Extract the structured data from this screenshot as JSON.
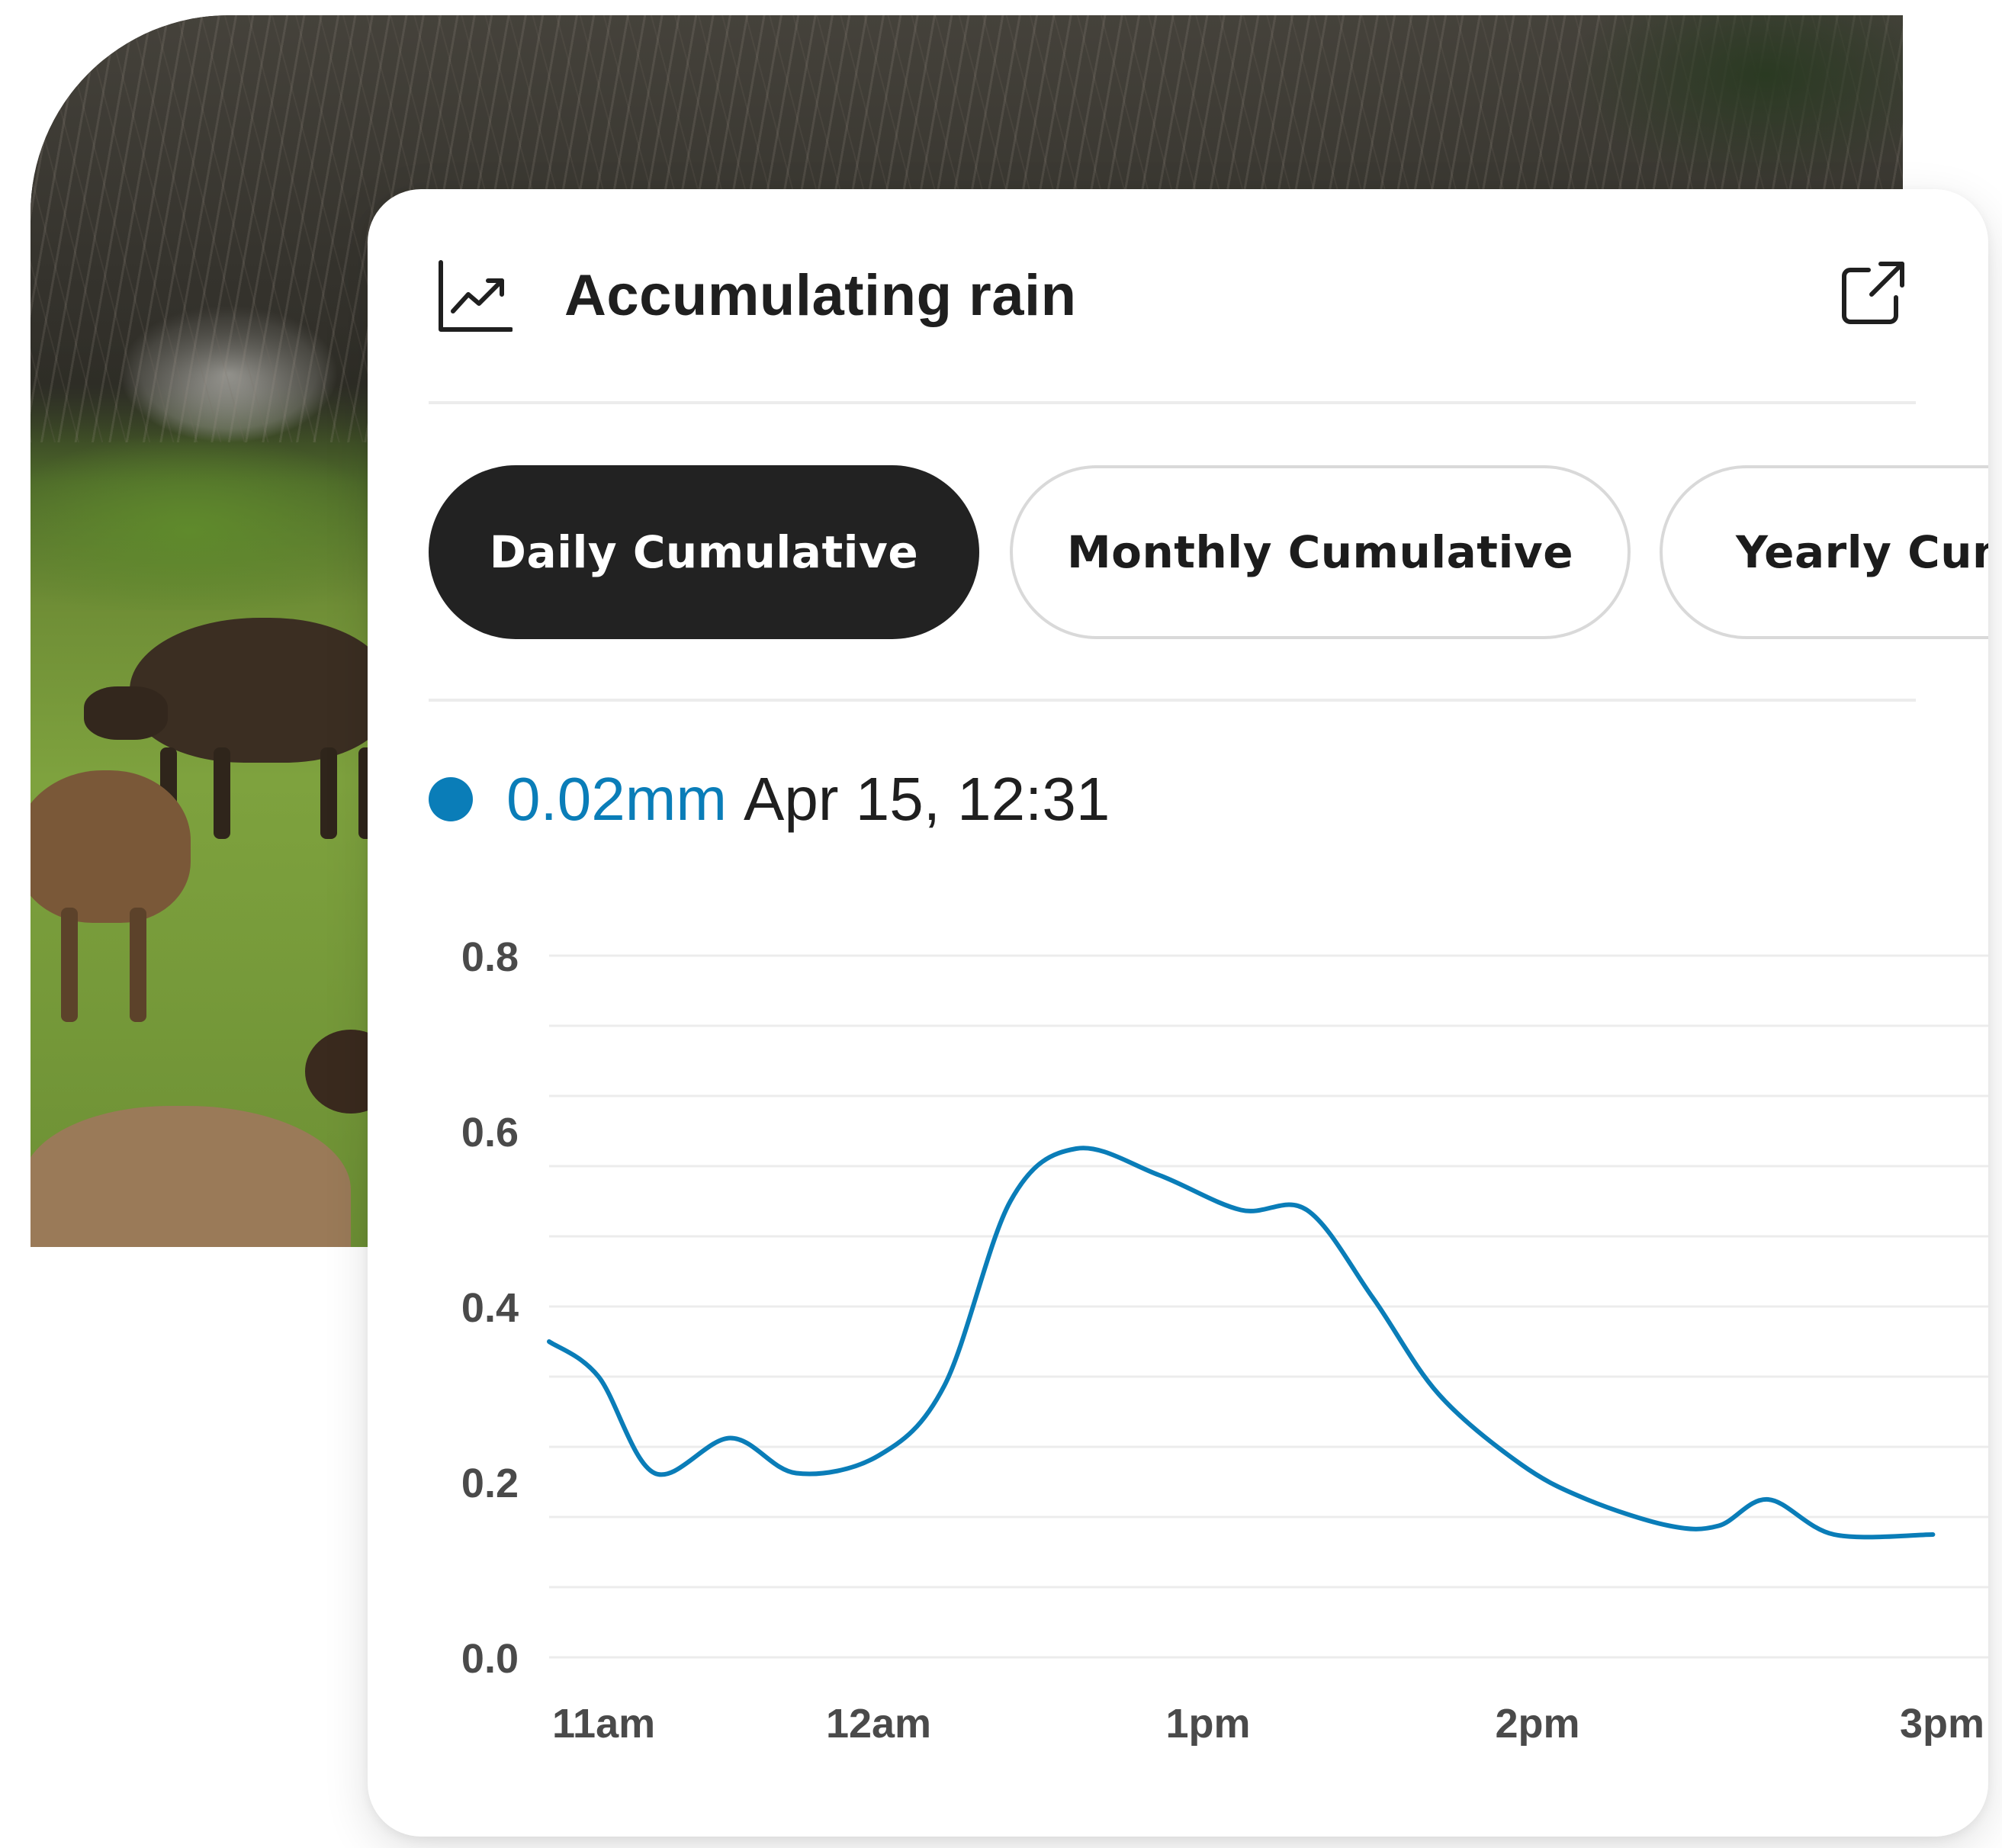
{
  "card": {
    "title": "Accumulating rain",
    "tabs": [
      {
        "label": "Daily Cumulative",
        "active": true
      },
      {
        "label": "Monthly Cumulative",
        "active": false
      },
      {
        "label": "Yearly Cumulative",
        "active": false
      }
    ],
    "readout": {
      "value": "0.02mm",
      "time": "Apr 15, 12:31"
    }
  },
  "icons": {
    "chart": "line-chart-icon",
    "external": "external-link-icon"
  },
  "colors": {
    "accent": "#0a7db8",
    "active_tab": "#222222",
    "text": "#1f1f1f",
    "tick": "#4a4a4a"
  },
  "chart_data": {
    "type": "line",
    "title": "Accumulating rain",
    "xlabel": "",
    "ylabel": "",
    "x_ticks": [
      "11am",
      "12am",
      "1pm",
      "2pm",
      "3pm"
    ],
    "y_ticks": [
      "0.8",
      "0.6",
      "0.4",
      "0.2",
      "0.0"
    ],
    "ylim": [
      0,
      0.8
    ],
    "grid": true,
    "legend": "none",
    "series": [
      {
        "color": "#0a7db8",
        "x": [
          0,
          0.15,
          0.32,
          0.55,
          0.75,
          1.0,
          1.2,
          1.4,
          1.6,
          1.85,
          2.1,
          2.3,
          2.5,
          2.7,
          2.95,
          3.15,
          3.4,
          3.55,
          3.7,
          3.9,
          4.2
        ],
        "y": [
          0.36,
          0.32,
          0.21,
          0.25,
          0.21,
          0.23,
          0.31,
          0.52,
          0.58,
          0.55,
          0.51,
          0.51,
          0.41,
          0.3,
          0.22,
          0.18,
          0.15,
          0.15,
          0.18,
          0.14,
          0.14
        ]
      }
    ]
  }
}
